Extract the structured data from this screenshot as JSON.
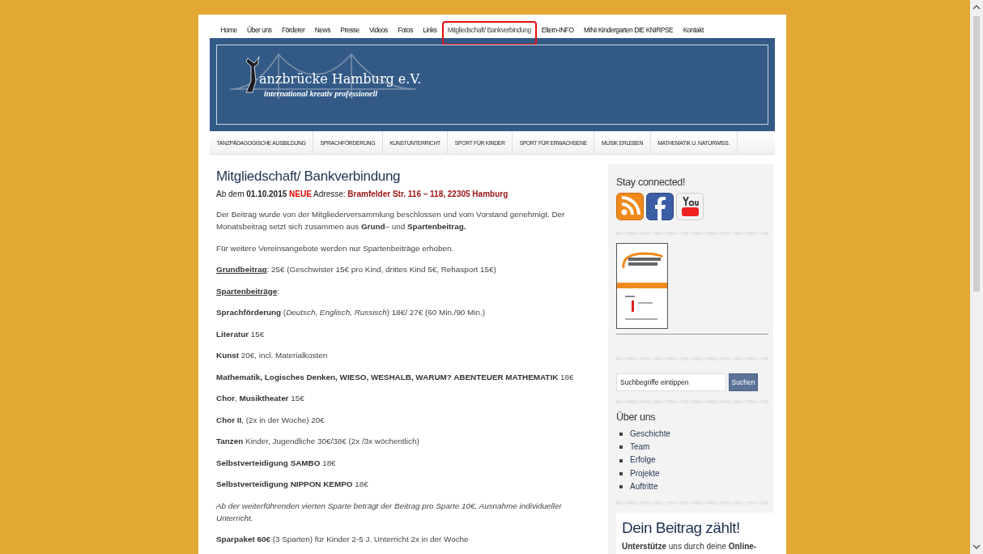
{
  "top_nav": [
    {
      "label": "Home",
      "selected": false
    },
    {
      "label": "Über uns",
      "selected": false
    },
    {
      "label": "Förderer",
      "selected": false
    },
    {
      "label": "News",
      "selected": false
    },
    {
      "label": "Presse",
      "selected": false
    },
    {
      "label": "Videos",
      "selected": false
    },
    {
      "label": "Fotos",
      "selected": false
    },
    {
      "label": "Links",
      "selected": false
    },
    {
      "label": "Mitgliedschaft/ Bankverbindung",
      "selected": true
    },
    {
      "label": "Eltern-INFO",
      "selected": false
    },
    {
      "label": "MINI Kindergarten DIE KNIRPSE",
      "selected": false
    },
    {
      "label": "Kontakt",
      "selected": false
    }
  ],
  "banner": {
    "logo_text": "anzbrücke Hamburg e.V.",
    "tagline": "international kreativ professionell"
  },
  "category_nav": [
    "TANZPÄDAGOGISCHE AUSBILDUNG",
    "SPRACHFÖRDERUNG",
    "KUNSTUNTERRICHT",
    "SPORT FÜR KINDER",
    "SPORT FÜR ERWACHSENE",
    "MUSIK ERLEBEN",
    "MATHEMATIK U. NATURWISS."
  ],
  "article": {
    "title": "Mitgliedschaft/ Bankverbindung",
    "notice": {
      "prefix": "Ab dem ",
      "date": "01.10.2015",
      "highlight": "NEUE",
      "middle": " Adresse: ",
      "address": "Bramfelder Str. 116 – 118, 22305 Hamburg"
    },
    "paragraphs": [
      {
        "kind": "text",
        "text": "Der Beitrag  wurde von der Mitgliederversammlung beschlossen und vom Vorstand genehmigt. Der Monatsbeitrag setzt sich zusammen aus **Grund**– und **Spartenbeitrag.**"
      },
      {
        "kind": "text",
        "text": "Für weitere Vereinsangebote werden nur Spartenbeiträge erhoben."
      },
      {
        "kind": "label",
        "label": "Grundbeitrag",
        "text": ": 25€ (Geschwister 15€ pro Kind, drittes Kind 5€, Rehasport 15€)"
      },
      {
        "kind": "label",
        "label": "Spartenbeiträge",
        "text": ":"
      },
      {
        "kind": "text",
        "text": "**Sprachförderung** (*Deutsch, Englisch, Russisch*) 18€/ 27€ (60 Min./90 Min.)"
      },
      {
        "kind": "text",
        "text": "**Literatur** 15€"
      },
      {
        "kind": "text",
        "text": "**Kunst** 20€,  incl. Materialkosten"
      },
      {
        "kind": "text",
        "text": "**Mathematik, Logisches Denken, WIESO, WESHALB, WARUM? ABENTEUER MATHEMATIK**  18€"
      },
      {
        "kind": "text",
        "text": "**Chor**, **Musiktheater** 15€"
      },
      {
        "kind": "text",
        "text": "**Chor II**, (2x in der Woche) 20€"
      },
      {
        "kind": "text",
        "text": "**Tanzen** Kinder, Jugendliche 30€/38€ (2x /3x wöchentlich)"
      },
      {
        "kind": "text",
        "text": "**Selbstverteidigung  SAMBO** 18€"
      },
      {
        "kind": "text",
        "text": "**Selbstverteidigung  NIPPON KEMPO** 18€"
      },
      {
        "kind": "note",
        "text": "Ab der weiterführenden vierten Sparte beträgt der Beitrag pro Sparte 10€, Ausnahme individueller Unterricht."
      },
      {
        "kind": "text",
        "text": "**Sparpaket 60€** (3 Sparten) für Kinder 2-5 J. Unterricht 2x in der Woche"
      }
    ]
  },
  "sidebar": {
    "social_title": "Stay connected!",
    "search": {
      "placeholder": "Suchbegriffe eintippen",
      "button": "Suchen"
    },
    "about_title": "Über uns",
    "about_links": [
      "Geschichte",
      "Team",
      "Erfolge",
      "Projekte",
      "Auftritte"
    ],
    "promo": {
      "title": "Dein Beitrag zählt!",
      "text": "**Unterstütze** uns durch deine **Online-**"
    }
  }
}
